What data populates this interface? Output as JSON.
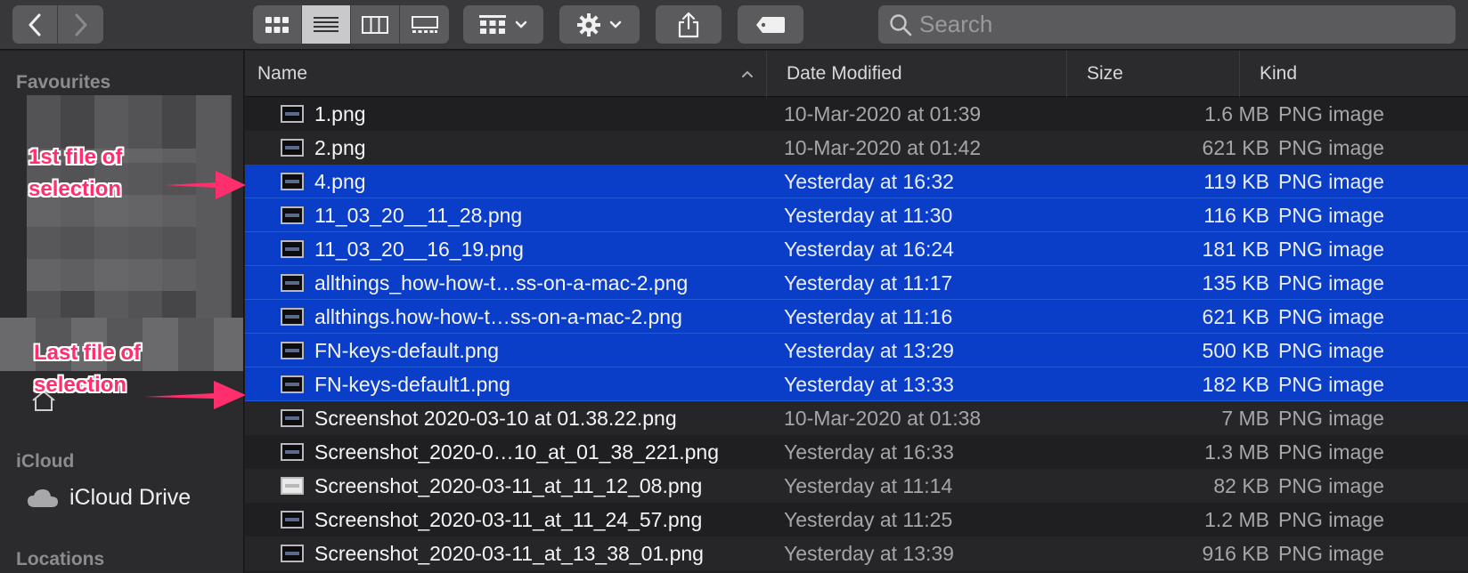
{
  "toolbar": {
    "search_placeholder": "Search"
  },
  "sidebar": {
    "favourites_label": "Favourites",
    "icloud_label": "iCloud",
    "icloud_drive_label": "iCloud Drive",
    "locations_label": "Locations"
  },
  "annotations": {
    "first_line1": "1st file of",
    "first_line2": "selection",
    "last_line1": "Last file of",
    "last_line2": "selection",
    "color": "#ff2f6e"
  },
  "columns": {
    "name": "Name",
    "date": "Date Modified",
    "size": "Size",
    "kind": "Kind"
  },
  "files": [
    {
      "name": "1.png",
      "date": "10-Mar-2020 at 01:39",
      "size": "1.6 MB",
      "kind": "PNG image",
      "selected": false
    },
    {
      "name": "2.png",
      "date": "10-Mar-2020 at 01:42",
      "size": "621 KB",
      "kind": "PNG image",
      "selected": false
    },
    {
      "name": "4.png",
      "date": "Yesterday at 16:32",
      "size": "119 KB",
      "kind": "PNG image",
      "selected": true
    },
    {
      "name": "11_03_20__11_28.png",
      "date": "Yesterday at 11:30",
      "size": "116 KB",
      "kind": "PNG image",
      "selected": true
    },
    {
      "name": "11_03_20__16_19.png",
      "date": "Yesterday at 16:24",
      "size": "181 KB",
      "kind": "PNG image",
      "selected": true
    },
    {
      "name": "allthings_how-how-t…ss-on-a-mac-2.png",
      "date": "Yesterday at 11:17",
      "size": "135 KB",
      "kind": "PNG image",
      "selected": true
    },
    {
      "name": "allthings.how-how-t…ss-on-a-mac-2.png",
      "date": "Yesterday at 11:16",
      "size": "621 KB",
      "kind": "PNG image",
      "selected": true
    },
    {
      "name": "FN-keys-default.png",
      "date": "Yesterday at 13:29",
      "size": "500 KB",
      "kind": "PNG image",
      "selected": true
    },
    {
      "name": "FN-keys-default1.png",
      "date": "Yesterday at 13:33",
      "size": "182 KB",
      "kind": "PNG image",
      "selected": true
    },
    {
      "name": "Screenshot 2020-03-10 at 01.38.22.png",
      "date": "10-Mar-2020 at 01:38",
      "size": "7 MB",
      "kind": "PNG image",
      "selected": false
    },
    {
      "name": "Screenshot_2020-0…10_at_01_38_221.png",
      "date": "Yesterday at 16:33",
      "size": "1.3 MB",
      "kind": "PNG image",
      "selected": false
    },
    {
      "name": "Screenshot_2020-03-11_at_11_12_08.png",
      "date": "Yesterday at 11:14",
      "size": "82 KB",
      "kind": "PNG image",
      "selected": false
    },
    {
      "name": "Screenshot_2020-03-11_at_11_24_57.png",
      "date": "Yesterday at 11:25",
      "size": "1.2 MB",
      "kind": "PNG image",
      "selected": false
    },
    {
      "name": "Screenshot_2020-03-11_at_13_38_01.png",
      "date": "Yesterday at 13:39",
      "size": "916 KB",
      "kind": "PNG image",
      "selected": false
    }
  ],
  "colors": {
    "selection": "#0a3ec8",
    "accent_annotation": "#ff2f6e"
  }
}
